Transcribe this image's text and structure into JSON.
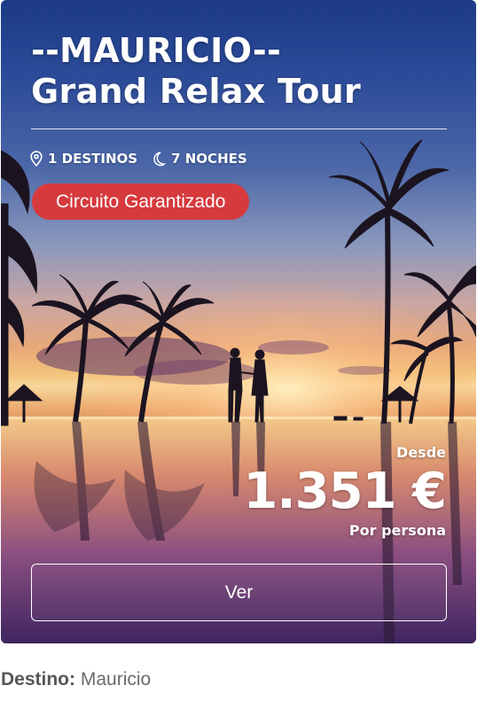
{
  "tour": {
    "title_line1": "--MAURICIO--",
    "title_line2": "Grand Relax Tour",
    "destinations": "1 DESTINOS",
    "nights": "7 NOCHES",
    "badge": "Circuito Garantizado",
    "price_prefix": "Desde",
    "price": "1.351 €",
    "price_suffix": "Por persona",
    "view_button": "Ver"
  },
  "footer": {
    "destino_label": "Destino:",
    "destino_value": "Mauricio"
  },
  "icons": {
    "destinations": "location-pin-icon",
    "nights": "moon-icon"
  },
  "colors": {
    "badge": "#d63a3d",
    "text_on_image": "#ffffff",
    "footer_text": "#6b6b6b"
  }
}
